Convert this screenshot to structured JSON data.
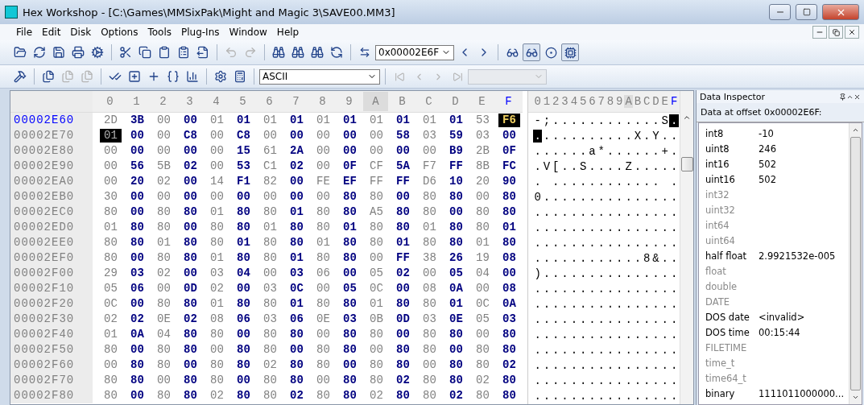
{
  "window": {
    "title": "Hex Workshop - [C:\\Games\\MMSixPak\\Might and Magic 3\\SAVE00.MM3]"
  },
  "menu": [
    {
      "label": "File"
    },
    {
      "label": "Edit"
    },
    {
      "label": "Disk"
    },
    {
      "label": "Options"
    },
    {
      "label": "Tools"
    },
    {
      "label": "Plug-Ins"
    },
    {
      "label": "Window"
    },
    {
      "label": "Help"
    }
  ],
  "toolbar_1": {
    "groups": [
      [
        {
          "disabled": false
        },
        {
          "disabled": false
        },
        {
          "disabled": false
        },
        {
          "disabled": false
        },
        {
          "disabled": false
        }
      ],
      [
        {
          "disabled": false
        },
        {
          "disabled": false
        },
        {
          "disabled": false
        },
        {
          "disabled": false
        },
        {
          "disabled": false
        }
      ],
      [
        {
          "disabled": true
        },
        {
          "disabled": true
        }
      ],
      [
        {
          "disabled": false
        },
        {
          "disabled": false
        },
        {
          "disabled": false
        },
        {
          "disabled": false
        }
      ]
    ],
    "address": {
      "value": "0x00002E6F"
    },
    "toggles": [
      {
        "pressed": false
      },
      {
        "pressed": true
      },
      {
        "pressed": false
      },
      {
        "pressed": true
      }
    ]
  },
  "toolbar_2": {
    "groups": [
      [
        {
          "disabled": false
        }
      ],
      [
        {
          "disabled": false
        },
        {
          "disabled": true
        },
        {
          "disabled": true
        }
      ],
      [
        {
          "disabled": false
        },
        {
          "disabled": false
        },
        {
          "disabled": false
        },
        {
          "disabled": false
        },
        {
          "disabled": false
        }
      ],
      [
        {
          "disabled": false
        },
        {
          "disabled": false
        }
      ]
    ],
    "encoding": {
      "value": "ASCII"
    },
    "nav": [
      {
        "disabled": true
      },
      {
        "disabled": true
      },
      {
        "disabled": true
      },
      {
        "disabled": true
      }
    ]
  },
  "hex_view": {
    "columns": [
      {
        "label": "0",
        "selected": false,
        "hovered": false
      },
      {
        "label": "1",
        "selected": false,
        "hovered": false
      },
      {
        "label": "2",
        "selected": false,
        "hovered": false
      },
      {
        "label": "3",
        "selected": false,
        "hovered": false
      },
      {
        "label": "4",
        "selected": false,
        "hovered": false
      },
      {
        "label": "5",
        "selected": false,
        "hovered": false
      },
      {
        "label": "6",
        "selected": false,
        "hovered": false
      },
      {
        "label": "7",
        "selected": false,
        "hovered": false
      },
      {
        "label": "8",
        "selected": false,
        "hovered": false
      },
      {
        "label": "9",
        "selected": false,
        "hovered": false
      },
      {
        "label": "A",
        "selected": false,
        "hovered": true
      },
      {
        "label": "B",
        "selected": false,
        "hovered": false
      },
      {
        "label": "C",
        "selected": false,
        "hovered": false
      },
      {
        "label": "D",
        "selected": false,
        "hovered": false
      },
      {
        "label": "E",
        "selected": false,
        "hovered": false
      },
      {
        "label": "F",
        "selected": true,
        "hovered": false
      }
    ],
    "text_header": "0123456789ABCDEF",
    "rows": [
      {
        "offset": "00002E60",
        "bytes": "2D 3B 00 00 01 01 01 01 01 01 01 01 01 01 53 F6",
        "text": "-;............S.",
        "selected": true,
        "first_byte_selected": false,
        "last_byte_selected": true
      },
      {
        "offset": "00002E70",
        "bytes": "01 00 00 C8 00 C8 00 00 00 00 00 58 03 59 03 00",
        "text": "...........X.Y..",
        "selected": false,
        "first_byte_selected": true,
        "last_byte_selected": false
      },
      {
        "offset": "00002E80",
        "bytes": "00 00 00 00 00 15 61 2A 00 00 00 00 00 B9 2B 0F",
        "text": "......a*......+.",
        "selected": false,
        "first_byte_selected": false,
        "last_byte_selected": false
      },
      {
        "offset": "00002E90",
        "bytes": "00 56 5B 02 00 53 C1 02 00 0F CF 5A F7 FF 8B FC",
        "text": ".V[..S....Z.....",
        "selected": false,
        "first_byte_selected": false,
        "last_byte_selected": false
      },
      {
        "offset": "00002EA0",
        "bytes": "00 20 02 00 14 F1 82 00 FE EF FF FF D6 10 20 90",
        "text": ". ............ .",
        "selected": false,
        "first_byte_selected": false,
        "last_byte_selected": false
      },
      {
        "offset": "00002EB0",
        "bytes": "30 00 00 00 00 00 00 00 00 80 80 00 80 80 00 80",
        "text": "0...............",
        "selected": false,
        "first_byte_selected": false,
        "last_byte_selected": false
      },
      {
        "offset": "00002EC0",
        "bytes": "80 00 80 80 01 80 80 01 80 80 A5 80 80 00 80 80",
        "text": "................",
        "selected": false,
        "first_byte_selected": false,
        "last_byte_selected": false
      },
      {
        "offset": "00002ED0",
        "bytes": "01 80 80 00 80 80 01 80 80 01 80 80 01 80 80 01",
        "text": "................",
        "selected": false,
        "first_byte_selected": false,
        "last_byte_selected": false
      },
      {
        "offset": "00002EE0",
        "bytes": "80 80 01 80 80 01 80 80 01 80 80 01 80 80 01 80",
        "text": "................",
        "selected": false,
        "first_byte_selected": false,
        "last_byte_selected": false
      },
      {
        "offset": "00002EF0",
        "bytes": "80 00 80 80 01 80 80 01 80 80 00 FF 38 26 19 08",
        "text": "............8&..",
        "selected": false,
        "first_byte_selected": false,
        "last_byte_selected": false
      },
      {
        "offset": "00002F00",
        "bytes": "29 03 02 00 03 04 00 03 06 00 05 02 00 05 04 00",
        "text": ")...............",
        "selected": false,
        "first_byte_selected": false,
        "last_byte_selected": false
      },
      {
        "offset": "00002F10",
        "bytes": "05 06 00 0D 02 00 03 0C 00 05 0C 00 08 0A 00 08",
        "text": "................",
        "selected": false,
        "first_byte_selected": false,
        "last_byte_selected": false
      },
      {
        "offset": "00002F20",
        "bytes": "0C 00 80 80 01 80 80 01 80 80 01 80 80 01 0C 0A",
        "text": "................",
        "selected": false,
        "first_byte_selected": false,
        "last_byte_selected": false
      },
      {
        "offset": "00002F30",
        "bytes": "02 02 0E 02 08 06 03 06 0E 03 0B 0D 03 0E 05 03",
        "text": "................",
        "selected": false,
        "first_byte_selected": false,
        "last_byte_selected": false
      },
      {
        "offset": "00002F40",
        "bytes": "01 0A 04 80 80 00 80 80 00 80 80 00 80 80 00 80",
        "text": "................",
        "selected": false,
        "first_byte_selected": false,
        "last_byte_selected": false
      },
      {
        "offset": "00002F50",
        "bytes": "80 00 80 80 00 80 80 00 80 80 00 80 80 00 80 80",
        "text": "................",
        "selected": false,
        "first_byte_selected": false,
        "last_byte_selected": false
      },
      {
        "offset": "00002F60",
        "bytes": "00 80 80 00 80 80 02 80 80 00 80 80 00 80 80 02",
        "text": "................",
        "selected": false,
        "first_byte_selected": false,
        "last_byte_selected": false
      },
      {
        "offset": "00002F70",
        "bytes": "80 80 00 80 80 00 80 80 00 80 80 02 80 80 02 80",
        "text": "................",
        "selected": false,
        "first_byte_selected": false,
        "last_byte_selected": false
      },
      {
        "offset": "00002F80",
        "bytes": "80 00 80 80 02 80 80 02 80 80 02 80 80 02 80 80",
        "text": "................",
        "selected": false,
        "first_byte_selected": false,
        "last_byte_selected": false
      }
    ]
  },
  "inspector": {
    "title": "Data Inspector",
    "caption": "Data at offset 0x00002E6F:",
    "items": [
      {
        "label": "int8",
        "value": "-10",
        "disabled": false
      },
      {
        "label": "uint8",
        "value": "246",
        "disabled": false
      },
      {
        "label": "int16",
        "value": "502",
        "disabled": false
      },
      {
        "label": "uint16",
        "value": "502",
        "disabled": false
      },
      {
        "label": "int32",
        "disabled": true
      },
      {
        "label": "uint32",
        "disabled": true
      },
      {
        "label": "int64",
        "disabled": true
      },
      {
        "label": "uint64",
        "disabled": true
      },
      {
        "label": "half float",
        "value": "2.9921532e-005",
        "disabled": false
      },
      {
        "label": "float",
        "disabled": true
      },
      {
        "label": "double",
        "disabled": true
      },
      {
        "label": "DATE",
        "disabled": true
      },
      {
        "label": "DOS date",
        "value": "<invalid>",
        "disabled": false
      },
      {
        "label": "DOS time",
        "value": "00:15:44",
        "disabled": false
      },
      {
        "label": "FILETIME",
        "disabled": true
      },
      {
        "label": "time_t",
        "disabled": true
      },
      {
        "label": "time64_t",
        "disabled": true
      },
      {
        "label": "binary",
        "value": "1111011000000...",
        "disabled": false
      }
    ]
  }
}
